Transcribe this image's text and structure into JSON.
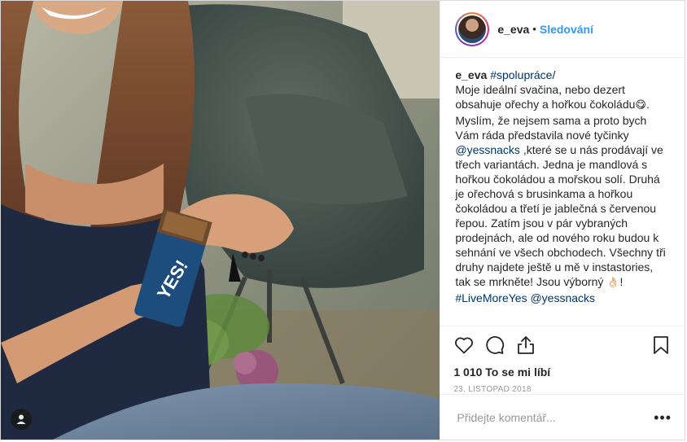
{
  "header": {
    "username": "e_eva",
    "separator": "•",
    "follow_label": "Sledování"
  },
  "caption": {
    "username": "e_eva",
    "hashtag_spoluprace": "#spolupráce",
    "slash": "/",
    "text_1": "Moje ideální svačina, nebo dezert obsahuje ořechy a hořkou čokoládu",
    "emoji_1": "😋",
    "text_2": ". Myslím, že nejsem sama a proto bych Vám ráda představila nové tyčinky ",
    "mention_1": "@yessnacks",
    "text_3": " ,které se u nás prodávají ve třech variantách. Jedna je mandlová s hořkou čokoládou a mořskou solí. Druhá je ořechová s brusinkama a hořkou čokoládou a třetí je jablečná s červenou řepou. Zatím jsou v pár vybraných prodejnách, ale od nového roku budou k sehnání ve všech obchodech. Všechny tři druhy najdete ještě u mě v instastories, tak se mrkněte! Jsou výborný ",
    "emoji_2": "👌🏻",
    "text_4": "!",
    "hashtag_livemoreyes": "#LiveMoreYes",
    "mention_2": "@yessnacks"
  },
  "actions": {
    "like_icon": "heart-icon",
    "comment_icon": "comment-icon",
    "share_icon": "share-icon",
    "save_icon": "bookmark-icon",
    "likes_count": "1 010",
    "likes_label": "To se mi líbí",
    "date": "23. LISTOPAD 2018"
  },
  "comment": {
    "placeholder": "Přidejte komentář...",
    "more_label": "•••"
  },
  "photo": {
    "product_label": "YES!",
    "tag_icon": "user-tag-icon"
  },
  "colors": {
    "link": "#003569",
    "follow": "#3897f0",
    "muted": "#999999",
    "text": "#262626"
  }
}
